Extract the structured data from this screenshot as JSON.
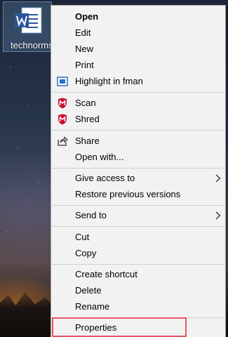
{
  "desktop": {
    "file_label": "technorms",
    "file_icon": "word-document-icon"
  },
  "menu": {
    "items": [
      {
        "label": "Open",
        "icon": null,
        "bold": true
      },
      {
        "label": "Edit",
        "icon": null
      },
      {
        "label": "New",
        "icon": null
      },
      {
        "label": "Print",
        "icon": null
      },
      {
        "label": "Highlight in fman",
        "icon": "fman-icon"
      },
      {
        "label": "Scan",
        "icon": "mcafee-shield-icon"
      },
      {
        "label": "Shred",
        "icon": "mcafee-shield-icon"
      },
      {
        "label": "Share",
        "icon": "share-icon"
      },
      {
        "label": "Open with...",
        "icon": null
      },
      {
        "label": "Give access to",
        "icon": null,
        "submenu": true
      },
      {
        "label": "Restore previous versions",
        "icon": null
      },
      {
        "label": "Send to",
        "icon": null,
        "submenu": true
      },
      {
        "label": "Cut",
        "icon": null
      },
      {
        "label": "Copy",
        "icon": null
      },
      {
        "label": "Create shortcut",
        "icon": null
      },
      {
        "label": "Delete",
        "icon": null
      },
      {
        "label": "Rename",
        "icon": null
      },
      {
        "label": "Properties",
        "icon": null,
        "highlighted": true
      }
    ]
  },
  "colors": {
    "menu_background": "#f2f2f2",
    "highlight_border": "#e5575f",
    "mcafee_red": "#c8102e",
    "fman_blue": "#2b6fc2"
  }
}
